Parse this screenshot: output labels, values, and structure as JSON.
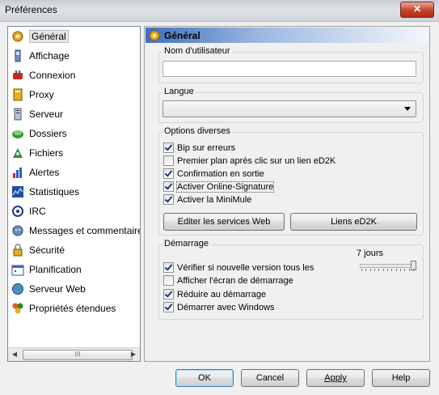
{
  "window": {
    "title": "Préférences",
    "close_label": "✕"
  },
  "sidebar": {
    "items": [
      {
        "label": "Général",
        "icon": "gear-icon",
        "selected": true
      },
      {
        "label": "Affichage",
        "icon": "display-icon"
      },
      {
        "label": "Connexion",
        "icon": "connection-icon"
      },
      {
        "label": "Proxy",
        "icon": "proxy-icon"
      },
      {
        "label": "Serveur",
        "icon": "server-icon"
      },
      {
        "label": "Dossiers",
        "icon": "folders-icon"
      },
      {
        "label": "Fichiers",
        "icon": "files-icon"
      },
      {
        "label": "Alertes",
        "icon": "alerts-icon"
      },
      {
        "label": "Statistiques",
        "icon": "statistics-icon"
      },
      {
        "label": "IRC",
        "icon": "irc-icon"
      },
      {
        "label": "Messages et commentaires",
        "icon": "messages-icon"
      },
      {
        "label": "Sécurité",
        "icon": "lock-icon"
      },
      {
        "label": "Planification",
        "icon": "schedule-icon"
      },
      {
        "label": "Serveur Web",
        "icon": "globe-icon"
      },
      {
        "label": "Propriétés étendues",
        "icon": "extended-icon"
      }
    ],
    "scroll_grip": "III"
  },
  "panel": {
    "title": "Général",
    "username": {
      "legend": "Nom d'utilisateur",
      "value": ""
    },
    "language": {
      "legend": "Langue",
      "selected": ""
    },
    "options": {
      "legend": "Options diverses",
      "items": [
        {
          "label": "Bip sur erreurs",
          "checked": true
        },
        {
          "label": "Premier plan après clic sur un lien eD2K",
          "checked": false
        },
        {
          "label": "Confirmation en sortie",
          "checked": true
        },
        {
          "label": "Activer Online-Signature",
          "checked": true,
          "focused": true
        },
        {
          "label": "Activer la MiniMule",
          "checked": true
        }
      ],
      "button_web": "Editer les services Web",
      "button_links": "Liens eD2K"
    },
    "startup": {
      "legend": "Démarrage",
      "slider_value_label": "7 jours",
      "slider_level": 1.0,
      "items": [
        {
          "label": "Vérifier si nouvelle version tous les",
          "checked": true
        },
        {
          "label": "Afficher l'écran de démarrage",
          "checked": false
        },
        {
          "label": "Réduire au démarrage",
          "checked": true
        },
        {
          "label": "Démarrer avec Windows",
          "checked": true
        }
      ]
    }
  },
  "footer": {
    "ok": "OK",
    "cancel": "Cancel",
    "apply": "Apply",
    "help": "Help"
  }
}
